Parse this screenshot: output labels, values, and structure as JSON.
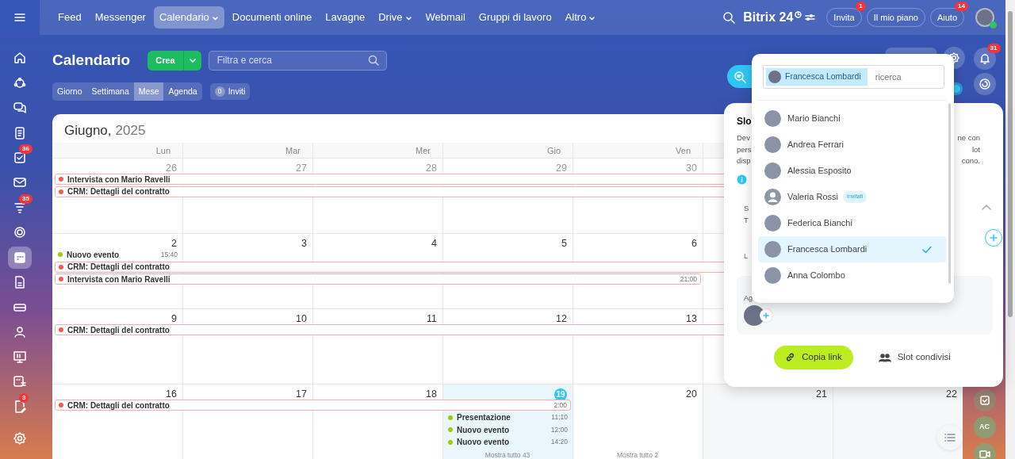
{
  "sidebar": {
    "items": [
      {
        "kind": "home",
        "selected": false
      },
      {
        "kind": "flow",
        "selected": false
      },
      {
        "kind": "chat",
        "selected": false
      },
      {
        "kind": "feed",
        "selected": false
      },
      {
        "kind": "tasks",
        "selected": false,
        "badge": "36"
      },
      {
        "kind": "mail",
        "selected": false
      },
      {
        "kind": "funnel",
        "selected": false,
        "badge": "35"
      },
      {
        "kind": "ring",
        "selected": false
      },
      {
        "kind": "calendar",
        "selected": true
      },
      {
        "kind": "document",
        "selected": false
      },
      {
        "kind": "drive",
        "selected": false
      },
      {
        "kind": "people",
        "selected": false
      },
      {
        "kind": "board",
        "selected": false
      },
      {
        "kind": "schedule",
        "selected": false
      },
      {
        "kind": "edit",
        "selected": false,
        "badge": "3"
      },
      {
        "kind": "settings",
        "selected": false
      }
    ]
  },
  "top_nav": {
    "items": [
      {
        "label": "Feed",
        "selected": false,
        "menu": false
      },
      {
        "label": "Messenger",
        "selected": false,
        "menu": false
      },
      {
        "label": "Calendario",
        "selected": true,
        "menu": true
      },
      {
        "label": "Documenti online",
        "selected": false,
        "menu": false
      },
      {
        "label": "Lavagne",
        "selected": false,
        "menu": false
      },
      {
        "label": "Drive",
        "selected": false,
        "menu": true
      },
      {
        "label": "Webmail",
        "selected": false,
        "menu": false
      },
      {
        "label": "Gruppi di lavoro",
        "selected": false,
        "menu": false
      },
      {
        "label": "Altro",
        "selected": false,
        "menu": true
      }
    ],
    "logo": "Bitrix 24",
    "buttons": [
      {
        "label": "Invita",
        "badge": "1"
      },
      {
        "label": "Il mio piano"
      },
      {
        "label": "Aiuto",
        "badge": "14"
      }
    ]
  },
  "calendar": {
    "title": "Calendario",
    "create": "Crea",
    "search_placeholder": "Filtra e cerca",
    "views": [
      {
        "label": "Giorno",
        "selected": false
      },
      {
        "label": "Settimana",
        "selected": false
      },
      {
        "label": "Mese",
        "selected": true
      },
      {
        "label": "Agenda",
        "selected": false
      }
    ],
    "invites": {
      "count": "0",
      "label": "Inviti"
    },
    "month": "Giugno,",
    "year": "2025",
    "weekdays": [
      "Lun",
      "Mar",
      "Mer",
      "Gio",
      "Ven"
    ],
    "weeks": [
      {
        "days": [
          {
            "label": "26",
            "other_month": true,
            "events": [
              {
                "kind": "bar",
                "title": "Intervista con Mario Ravelli",
                "color": "#f25a55"
              },
              {
                "kind": "bar",
                "title": "CRM: Dettagli del contratto",
                "color": "#f25a55"
              }
            ]
          },
          {
            "label": "27",
            "other_month": true,
            "events": [
              {
                "kind": "continued"
              },
              {
                "kind": "continued"
              }
            ]
          },
          {
            "label": "28",
            "other_month": true,
            "events": [
              {
                "kind": "continued"
              },
              {
                "kind": "continued"
              }
            ]
          },
          {
            "label": "29",
            "other_month": true,
            "events": [
              {
                "kind": "continued"
              },
              {
                "kind": "continued"
              }
            ]
          },
          {
            "label": "30",
            "other_month": true,
            "events": [
              {
                "kind": "continued"
              },
              {
                "kind": "continued"
              }
            ]
          },
          {
            "events": [
              {
                "kind": "continued"
              },
              {
                "kind": "continued"
              }
            ]
          },
          {
            "events": [
              {
                "kind": "continued"
              },
              {
                "kind": "continued"
              }
            ]
          }
        ]
      },
      {
        "days": [
          {
            "label": "2",
            "events": [
              {
                "kind": "dot",
                "title": "Nuovo evento",
                "time": "15:40",
                "color": "#9dcf00"
              },
              {
                "kind": "bar",
                "title": "CRM: Dettagli del contratto",
                "color": "#f25a55"
              },
              {
                "kind": "bar",
                "title": "Intervista con Mario Ravelli",
                "time": "21:00",
                "color": "#f25a55"
              }
            ]
          },
          {
            "label": "3",
            "events": [
              {
                "kind": "empty"
              },
              {
                "kind": "continued"
              },
              {
                "kind": "continued"
              }
            ]
          },
          {
            "label": "4",
            "events": [
              {
                "kind": "empty"
              },
              {
                "kind": "continued"
              },
              {
                "kind": "continued"
              }
            ]
          },
          {
            "label": "5",
            "events": [
              {
                "kind": "empty"
              },
              {
                "kind": "continued"
              },
              {
                "kind": "continued"
              }
            ]
          },
          {
            "label": "6",
            "events": [
              {
                "kind": "empty"
              },
              {
                "kind": "continued"
              },
              {
                "kind": "continued"
              }
            ]
          },
          {
            "events": [
              {
                "kind": "empty"
              },
              {
                "kind": "continued"
              }
            ]
          },
          {
            "events": [
              {
                "kind": "empty"
              },
              {
                "kind": "continued"
              }
            ]
          }
        ]
      },
      {
        "days": [
          {
            "label": "9",
            "events": [
              {
                "kind": "bar",
                "title": "CRM: Dettagli del contratto",
                "color": "#f25a55"
              }
            ]
          },
          {
            "label": "10",
            "events": [
              {
                "kind": "continued"
              }
            ]
          },
          {
            "label": "11",
            "events": [
              {
                "kind": "continued"
              }
            ]
          },
          {
            "label": "12",
            "events": [
              {
                "kind": "continued"
              }
            ]
          },
          {
            "label": "13",
            "events": [
              {
                "kind": "continued"
              }
            ]
          },
          {
            "events": [
              {
                "kind": "continued"
              }
            ]
          },
          {
            "events": [
              {
                "kind": "continued"
              }
            ]
          }
        ]
      },
      {
        "days": [
          {
            "label": "16",
            "events": [
              {
                "kind": "bar",
                "title": "CRM: Dettagli del contratto",
                "time": "2:00",
                "color": "#f25a55"
              }
            ]
          },
          {
            "label": "17",
            "events": [
              {
                "kind": "continued"
              }
            ]
          },
          {
            "label": "18",
            "events": [
              {
                "kind": "continued"
              }
            ]
          },
          {
            "label": "19",
            "today": true,
            "more": "Mostra tutto 43",
            "events": [
              {
                "kind": "continued"
              },
              {
                "kind": "dot",
                "title": "Presentazione",
                "time": "11:10",
                "color": "#9dcf00"
              },
              {
                "kind": "dot",
                "title": "Nuovo evento",
                "time": "12:00",
                "color": "#9dcf00"
              },
              {
                "kind": "dot",
                "title": "Nuovo evento",
                "time": "14:20",
                "color": "#9dcf00"
              }
            ]
          },
          {
            "label": "20",
            "more": "Mostra tutto 2"
          },
          {
            "label": "21",
            "weekend": true
          },
          {
            "label": "22",
            "weekend": true
          }
        ]
      }
    ]
  },
  "slot_panel": {
    "title": "Slo",
    "text_left": [
      "Dev",
      "pers",
      "disp"
    ],
    "text_right": [
      "ne con",
      "lot",
      "cono."
    ],
    "fragments_top": [
      "S",
      "T"
    ],
    "fragment_mid": "L",
    "fragment_bottom": "Ag",
    "copy_button": "Copia link",
    "shared_button": "Slot condivisi"
  },
  "people_picker": {
    "chip": "Francesca Lombardi",
    "placeholder": "ricerca",
    "people": [
      {
        "name": "Mario Bianchi",
        "generic_avatar": false,
        "selected": false
      },
      {
        "name": "Andrea Ferrari",
        "generic_avatar": false,
        "selected": false
      },
      {
        "name": "Alessia Esposito",
        "generic_avatar": false,
        "selected": false
      },
      {
        "name": "Valeria Rossi",
        "generic_avatar": true,
        "selected": false,
        "tag": "Invitati"
      },
      {
        "name": "Federica Bianchi",
        "generic_avatar": false,
        "selected": false
      },
      {
        "name": "Francesca Lombardi",
        "generic_avatar": false,
        "selected": true
      },
      {
        "name": "Anna Colombo",
        "generic_avatar": false,
        "selected": false
      }
    ]
  },
  "right_rail": {
    "bell_badge": "31",
    "avatar_initials": "AC",
    "toggle_on": true
  }
}
